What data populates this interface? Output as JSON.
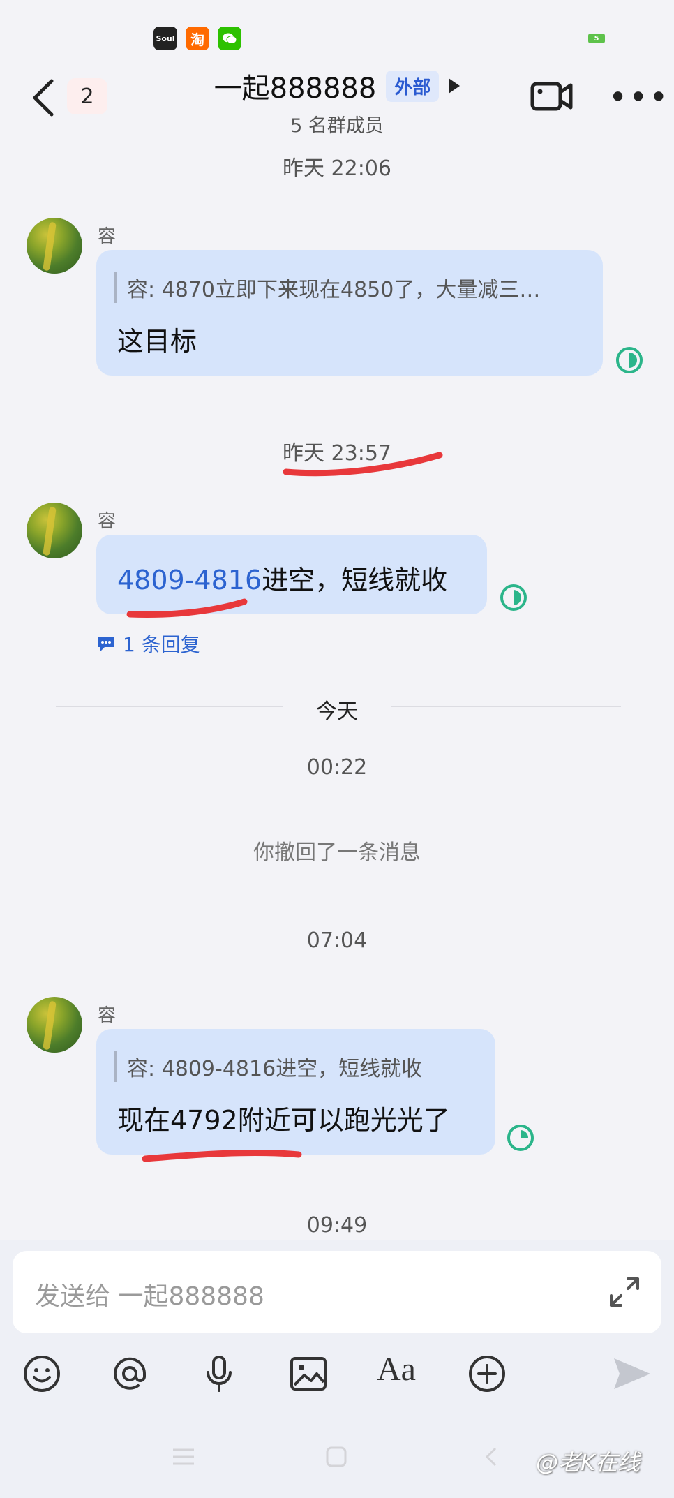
{
  "status_bar": {
    "app_icons": [
      "Soul",
      "淘",
      "WeChat"
    ],
    "battery": "5"
  },
  "header": {
    "unread_count": "2",
    "title": "一起888888",
    "tag": "外部",
    "subtitle": "5 名群成员"
  },
  "messages": [
    {
      "type": "timestamp",
      "text": "昨天 22:06"
    },
    {
      "type": "message",
      "sender": "容",
      "quote": "容: 4870立即下来现在4850了，大量减三…",
      "text": "这目标"
    },
    {
      "type": "timestamp",
      "text": "昨天 23:57"
    },
    {
      "type": "message",
      "sender": "容",
      "highlight": "4809-4816",
      "text": "进空，短线就收",
      "reply_count": "1 条回复"
    },
    {
      "type": "divider",
      "text": "今天"
    },
    {
      "type": "timestamp",
      "text": "00:22"
    },
    {
      "type": "system",
      "text": "你撤回了一条消息"
    },
    {
      "type": "timestamp",
      "text": "07:04"
    },
    {
      "type": "message",
      "sender": "容",
      "quote": "容: 4809-4816进空，短线就收",
      "text": "现在4792附近可以跑光光了"
    },
    {
      "type": "timestamp",
      "text": "09:49"
    }
  ],
  "composer": {
    "placeholder": "发送给 一起888888"
  },
  "toolbar": [
    "emoji-icon",
    "mention-icon",
    "voice-icon",
    "image-icon",
    "format-icon",
    "plus-icon",
    "send-icon"
  ],
  "watermark": "@老K在线",
  "colors": {
    "accent": "#2c63d0",
    "bubble": "#d6e4fb",
    "annotation": "#e8383b",
    "status": "#2bb58a"
  }
}
